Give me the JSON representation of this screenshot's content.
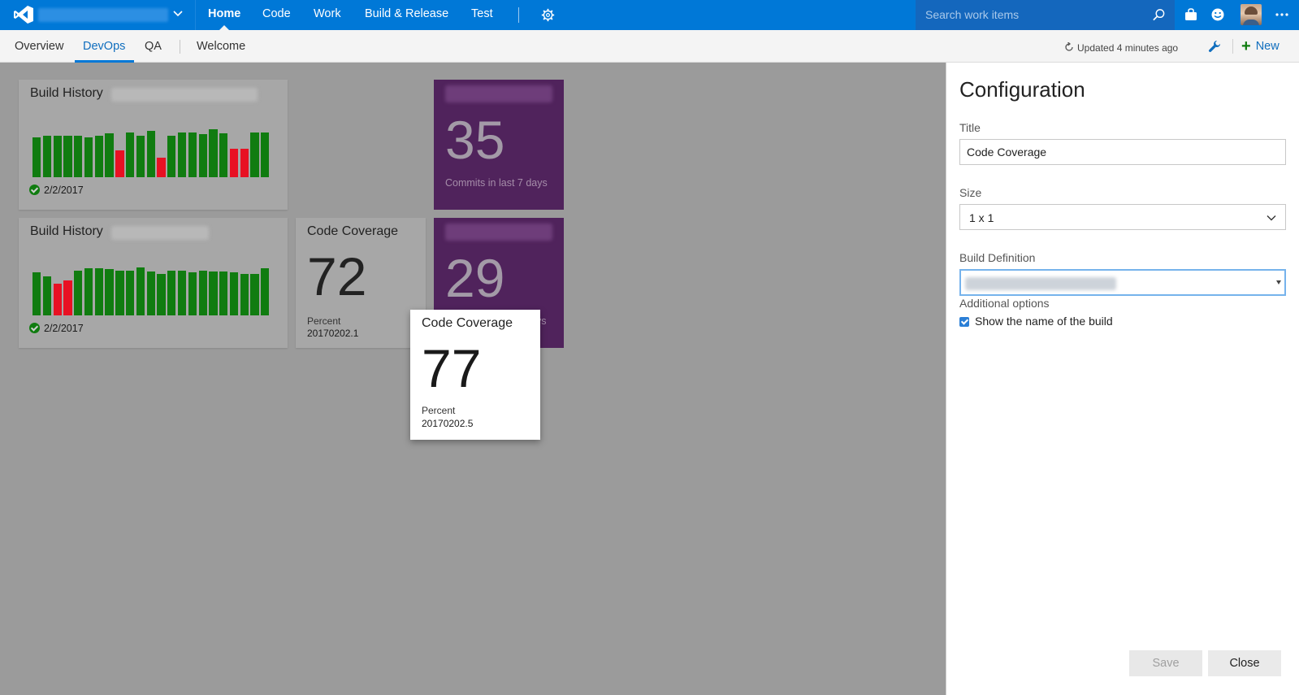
{
  "topnav": {
    "items": [
      "Home",
      "Code",
      "Work",
      "Build & Release",
      "Test"
    ],
    "search_placeholder": "Search work items"
  },
  "subnav": {
    "items": [
      "Overview",
      "DevOps",
      "QA",
      "Welcome"
    ],
    "updated": "Updated 4 minutes ago",
    "new_label": "New"
  },
  "tiles": {
    "build_history_1": {
      "title": "Build History",
      "date": "2/2/2017",
      "bars": [
        {
          "h": 0.82,
          "s": "pass"
        },
        {
          "h": 0.85,
          "s": "pass"
        },
        {
          "h": 0.85,
          "s": "pass"
        },
        {
          "h": 0.85,
          "s": "pass"
        },
        {
          "h": 0.85,
          "s": "pass"
        },
        {
          "h": 0.82,
          "s": "pass"
        },
        {
          "h": 0.85,
          "s": "pass"
        },
        {
          "h": 0.9,
          "s": "pass"
        },
        {
          "h": 0.55,
          "s": "fail"
        },
        {
          "h": 0.92,
          "s": "pass"
        },
        {
          "h": 0.85,
          "s": "pass"
        },
        {
          "h": 0.95,
          "s": "pass"
        },
        {
          "h": 0.4,
          "s": "fail"
        },
        {
          "h": 0.85,
          "s": "pass"
        },
        {
          "h": 0.92,
          "s": "pass"
        },
        {
          "h": 0.92,
          "s": "pass"
        },
        {
          "h": 0.88,
          "s": "pass"
        },
        {
          "h": 0.98,
          "s": "pass"
        },
        {
          "h": 0.9,
          "s": "pass"
        },
        {
          "h": 0.58,
          "s": "fail"
        },
        {
          "h": 0.58,
          "s": "fail"
        },
        {
          "h": 0.92,
          "s": "pass"
        },
        {
          "h": 0.92,
          "s": "pass"
        }
      ]
    },
    "build_history_2": {
      "title": "Build History",
      "date": "2/2/2017",
      "bars": [
        {
          "h": 0.88,
          "s": "pass"
        },
        {
          "h": 0.8,
          "s": "pass"
        },
        {
          "h": 0.65,
          "s": "fail"
        },
        {
          "h": 0.72,
          "s": "fail"
        },
        {
          "h": 0.92,
          "s": "pass"
        },
        {
          "h": 0.97,
          "s": "pass"
        },
        {
          "h": 0.97,
          "s": "pass"
        },
        {
          "h": 0.95,
          "s": "pass"
        },
        {
          "h": 0.92,
          "s": "pass"
        },
        {
          "h": 0.92,
          "s": "pass"
        },
        {
          "h": 0.98,
          "s": "pass"
        },
        {
          "h": 0.9,
          "s": "pass"
        },
        {
          "h": 0.85,
          "s": "pass"
        },
        {
          "h": 0.92,
          "s": "pass"
        },
        {
          "h": 0.92,
          "s": "pass"
        },
        {
          "h": 0.88,
          "s": "pass"
        },
        {
          "h": 0.92,
          "s": "pass"
        },
        {
          "h": 0.9,
          "s": "pass"
        },
        {
          "h": 0.9,
          "s": "pass"
        },
        {
          "h": 0.88,
          "s": "pass"
        },
        {
          "h": 0.85,
          "s": "pass"
        },
        {
          "h": 0.85,
          "s": "pass"
        },
        {
          "h": 0.97,
          "s": "pass"
        }
      ]
    },
    "commits_1": {
      "number": "35",
      "caption": "Commits in last 7 days"
    },
    "commits_2": {
      "number": "29",
      "caption_partial": "ys"
    },
    "coverage_1": {
      "title": "Code Coverage",
      "number": "72",
      "label": "Percent",
      "build": "20170202.1"
    },
    "coverage_drag": {
      "title": "Code Coverage",
      "number": "77",
      "label": "Percent",
      "build": "20170202.5"
    }
  },
  "config": {
    "title": "Configuration",
    "title_label": "Title",
    "title_value": "Code Coverage",
    "size_label": "Size",
    "size_value": "1 x 1",
    "build_def_label": "Build Definition",
    "additional_options": "Additional options",
    "show_name_label": "Show the name of the build",
    "save_label": "Save",
    "close_label": "Close"
  },
  "colors": {
    "accent": "#0078d7",
    "pass": "#107c10",
    "fail": "#e81123",
    "purple_tile": "#50235c"
  }
}
